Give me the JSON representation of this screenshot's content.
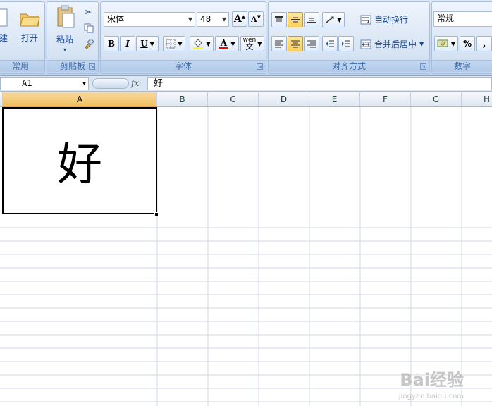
{
  "ribbon": {
    "common": {
      "new_label": "建",
      "open_label": "打开",
      "group_label": "常用"
    },
    "clipboard": {
      "paste_label": "粘贴",
      "group_label": "剪贴板"
    },
    "font": {
      "font_name": "宋体",
      "font_size": "48",
      "bold": "B",
      "italic": "I",
      "underline": "U",
      "font_color_label": "A",
      "phonetic_label": "wén",
      "grow_label": "A",
      "shrink_label": "A",
      "group_label": "字体",
      "font_color": "#ff0000",
      "fill_color": "#ffff00"
    },
    "alignment": {
      "wrap_text_label": "自动换行",
      "merge_center_label": "合并后居中",
      "group_label": "对齐方式"
    },
    "number": {
      "format": "常规",
      "percent_label": "%",
      "comma_label": ",",
      "group_label": "数字"
    }
  },
  "formula_bar": {
    "name_box": "A1",
    "fx_label": "fx",
    "content": "好"
  },
  "columns": [
    "A",
    "B",
    "C",
    "D",
    "E",
    "F",
    "G",
    "H"
  ],
  "selected_column": "A",
  "cells": {
    "A1": "好"
  },
  "watermark": {
    "brand": "Bai经验",
    "url": "jingyan.baidu.com"
  },
  "colors": {
    "accent": "#f1c15f",
    "ribbon_text": "#15428b",
    "gridline": "#d0d7e5"
  }
}
